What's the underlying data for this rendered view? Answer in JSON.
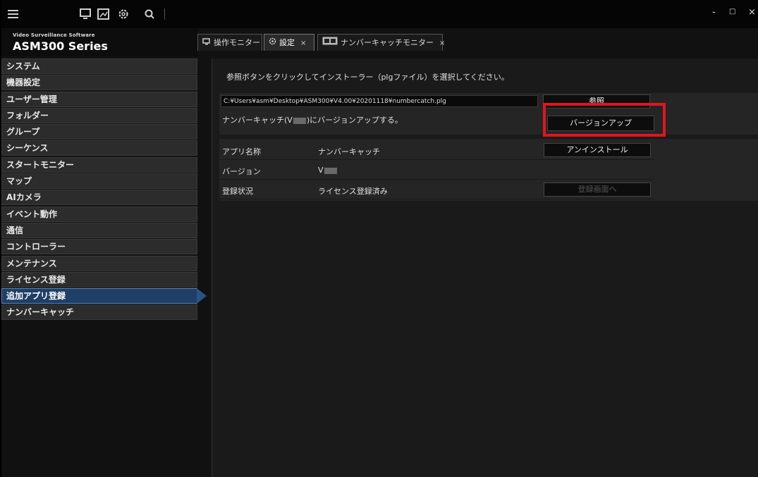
{
  "toolbar": {
    "icons": [
      "menu-icon",
      "monitor-icon",
      "layout-icon",
      "gear-icon",
      "search-icon"
    ]
  },
  "window": {
    "minimize": "-",
    "maximize": "□",
    "close": "×"
  },
  "logo": {
    "subtitle": "Video Surveillance Software",
    "title": "ASM300 Series"
  },
  "tabs": [
    {
      "label": "操作モニター",
      "closable": false
    },
    {
      "label": "設定",
      "closable": true
    },
    {
      "label": "ナンバーキャッチモニター",
      "closable": true
    }
  ],
  "tab_close": "×",
  "sidebar": {
    "items": [
      {
        "label": "システム"
      },
      {
        "label": "機器設定"
      },
      {
        "label": "ユーザー管理"
      },
      {
        "label": "フォルダー"
      },
      {
        "label": "グループ"
      },
      {
        "label": "シーケンス"
      },
      {
        "label": "スタートモニター"
      },
      {
        "label": "マップ"
      },
      {
        "label": "AIカメラ"
      },
      {
        "label": "イベント動作"
      },
      {
        "label": "通信"
      },
      {
        "label": "コントローラー"
      },
      {
        "label": "メンテナンス"
      },
      {
        "label": "ライセンス登録"
      },
      {
        "label": "追加アプリ登録"
      },
      {
        "label": "ナンバーキャッチ"
      }
    ],
    "active_index": 14
  },
  "main": {
    "instruction": "参照ボタンをクリックしてインストーラー（plgファイル）を選択してください。",
    "installer_path": "C:¥Users¥asm¥Desktop¥ASM300¥V4.00¥20201118¥numbercatch.plg",
    "browse_button": "参照",
    "upgrade_prefix": "ナンバーキャッチ(V",
    "upgrade_suffix": ")にバージョンアップする。",
    "upgrade_button": "バージョンアップ",
    "app_info": {
      "name_label": "アプリ名称",
      "name_value": "ナンバーキャッチ",
      "uninstall_button": "アンインストール",
      "version_label": "バージョン",
      "version_value": "V",
      "status_label": "登録状況",
      "status_value": "ライセンス登録済み",
      "register_button": "登録画面へ"
    }
  },
  "colors": {
    "highlight": "#e0161c",
    "active_item": "#1f3f66"
  }
}
